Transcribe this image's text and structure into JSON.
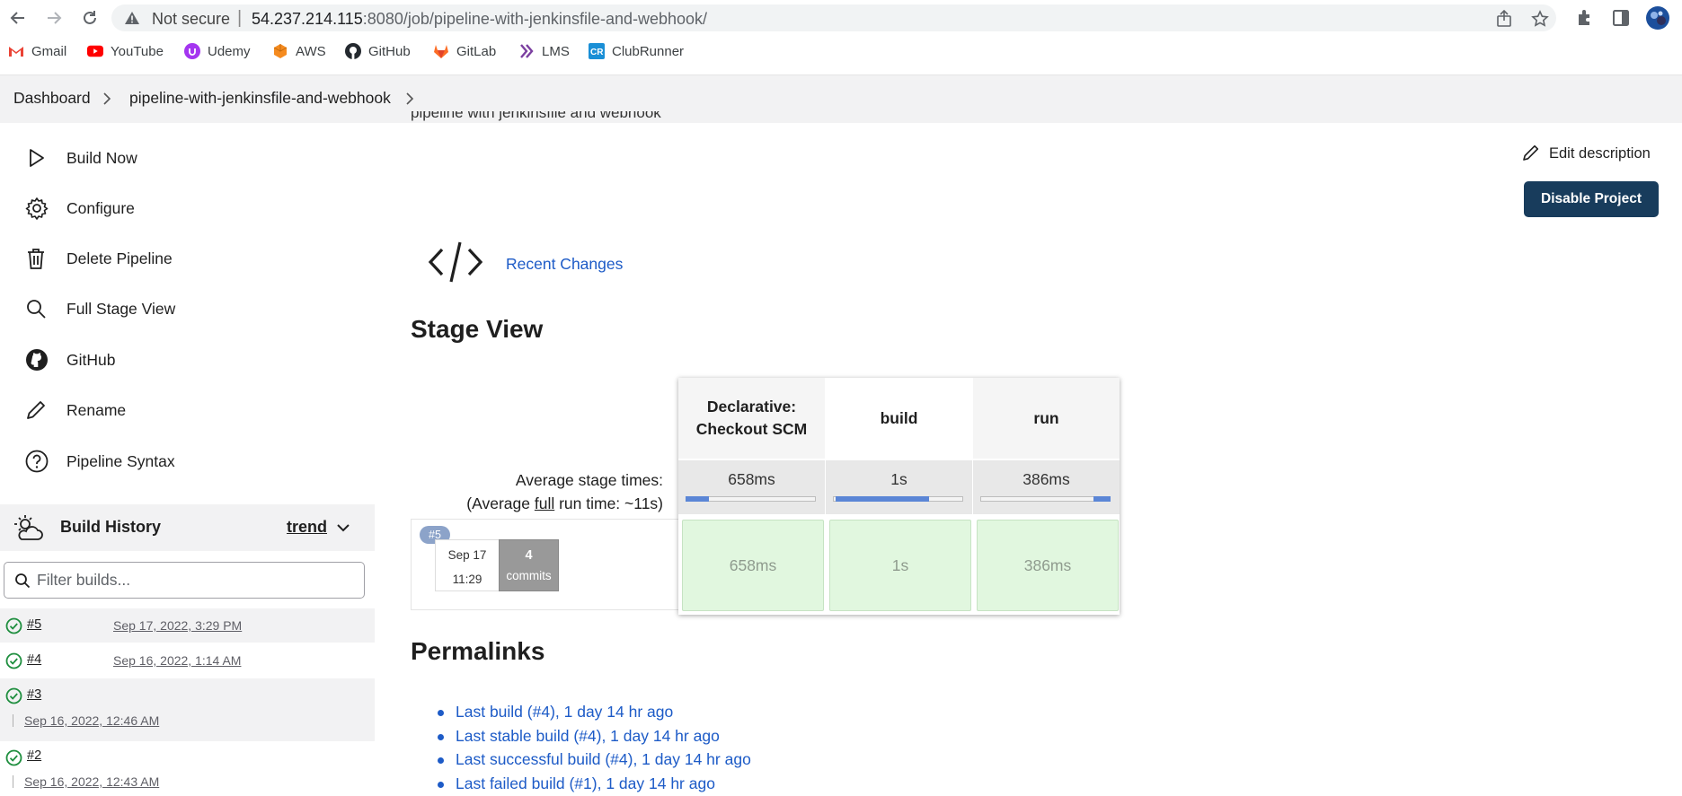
{
  "browser": {
    "security_label": "Not secure",
    "url_host": "54.237.214.115",
    "url_rest": ":8080/job/pipeline-with-jenkinsfile-and-webhook/",
    "bookmarks": [
      "Gmail",
      "YouTube",
      "Udemy",
      "AWS",
      "GitHub",
      "GitLab",
      "LMS",
      "ClubRunner"
    ]
  },
  "breadcrumb": {
    "items": [
      "Dashboard",
      "pipeline-with-jenkinsfile-and-webhook"
    ]
  },
  "sidebar": {
    "tasks": [
      "Build Now",
      "Configure",
      "Delete Pipeline",
      "Full Stage View",
      "GitHub",
      "Rename",
      "Pipeline Syntax"
    ]
  },
  "build_history": {
    "title": "Build History",
    "trend_label": "trend",
    "filter_placeholder": "Filter builds...",
    "builds": [
      {
        "number": "#5",
        "date": "Sep 17, 2022, 3:29 PM"
      },
      {
        "number": "#4",
        "date": "Sep 16, 2022, 1:14 AM"
      },
      {
        "number": "#3",
        "date": "Sep 16, 2022, 12:46 AM"
      },
      {
        "number": "#2",
        "date": "Sep 16, 2022, 12:43 AM"
      }
    ]
  },
  "main": {
    "description_partial": "pipeline with jenkinsfile and webhook",
    "edit_description_label": "Edit description",
    "disable_button_label": "Disable Project",
    "recent_changes_label": "Recent Changes",
    "stage_view_title": "Stage View",
    "permalinks_title": "Permalinks"
  },
  "stage_view": {
    "stage_line1": [
      "Declarative:",
      "build",
      "run"
    ],
    "stage_line2": [
      "Checkout SCM",
      "",
      ""
    ],
    "avg_label_line1": "Average stage times:",
    "avg_label_pre": "(Average ",
    "avg_label_full": "full",
    "avg_label_post": " run time: ~11s)",
    "avg_times": [
      "658ms",
      "1s",
      "386ms"
    ],
    "avg_fraction": [
      0.18,
      0.72,
      0.13
    ],
    "build": {
      "badge": "#5",
      "date": "Sep 17",
      "time": "11:29",
      "commits_count": "4",
      "commits_label": "commits",
      "stage_times": [
        "658ms",
        "1s",
        "386ms"
      ]
    }
  },
  "permalinks": [
    "Last build (#4), 1 day 14 hr ago",
    "Last stable build (#4), 1 day 14 hr ago",
    "Last successful build (#4), 1 day 14 hr ago",
    "Last failed build (#1), 1 day 14 hr ago"
  ],
  "colors": {
    "link": "#1d5bc7",
    "primary_button": "#183c5c",
    "stage_success": "#e1f7df",
    "success_icon": "#1e8e3e"
  }
}
